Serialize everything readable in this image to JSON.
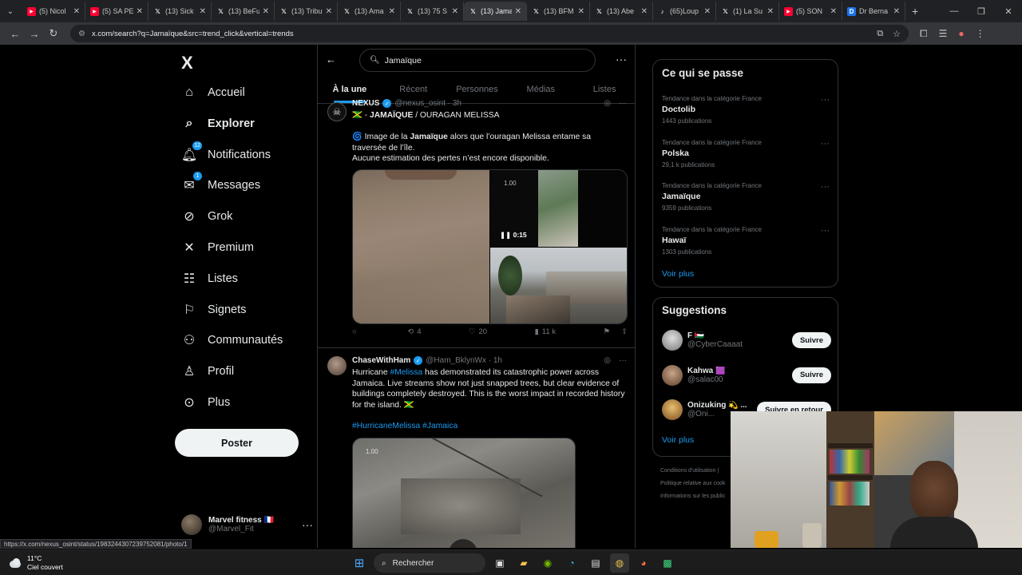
{
  "browser": {
    "tabs": [
      {
        "label": "(5) Nicol",
        "favicon": "youtube",
        "color": "#ff0033"
      },
      {
        "label": "(5) SA PE",
        "favicon": "youtube",
        "color": "#ff0033"
      },
      {
        "label": "(13) Sick",
        "favicon": "x",
        "color": "#000000"
      },
      {
        "label": "(13) BeFu",
        "favicon": "x",
        "color": "#000000"
      },
      {
        "label": "(13) Tribu",
        "favicon": "x",
        "color": "#000000"
      },
      {
        "label": "(13) Ama",
        "favicon": "x",
        "color": "#000000"
      },
      {
        "label": "(13) 75 S",
        "favicon": "x",
        "color": "#000000"
      },
      {
        "label": "(13) Jama",
        "favicon": "x",
        "color": "#000000",
        "active": true
      },
      {
        "label": "(13) BFM",
        "favicon": "x",
        "color": "#000000"
      },
      {
        "label": "(13) Abe",
        "favicon": "x",
        "color": "#000000"
      },
      {
        "label": "(65)Loup",
        "favicon": "tiktok",
        "color": "#000000"
      },
      {
        "label": "(1) La Su",
        "favicon": "x",
        "color": "#000000"
      },
      {
        "label": "(5) SON",
        "favicon": "youtube",
        "color": "#ff0033"
      },
      {
        "label": "Dr Berna",
        "favicon": "doc",
        "color": "#1a73e8"
      }
    ],
    "url": "x.com/search?q=Jamaïque&src=trend_click&vertical=trends",
    "status_url": "https://x.com/nexus_osint/status/1983244307239752081/photo/1"
  },
  "sidebar": {
    "logo": "X",
    "items": [
      {
        "label": "Accueil",
        "icon": "home-icon"
      },
      {
        "label": "Explorer",
        "icon": "search-icon",
        "bold": true
      },
      {
        "label": "Notifications",
        "icon": "bell-icon",
        "badge": "12"
      },
      {
        "label": "Messages",
        "icon": "mail-icon",
        "badge": "1"
      },
      {
        "label": "Grok",
        "icon": "grok-icon"
      },
      {
        "label": "Premium",
        "icon": "x-icon"
      },
      {
        "label": "Listes",
        "icon": "list-icon"
      },
      {
        "label": "Signets",
        "icon": "bookmark-icon"
      },
      {
        "label": "Communautés",
        "icon": "people-icon"
      },
      {
        "label": "Profil",
        "icon": "person-icon"
      },
      {
        "label": "Plus",
        "icon": "more-circle-icon"
      }
    ],
    "post_label": "Poster",
    "account": {
      "name": "Marvel fitness 🇫🇷",
      "handle": "@Marvel_Fit"
    }
  },
  "search": {
    "query": "Jamaïque",
    "tabs": [
      "À la une",
      "Récent",
      "Personnes",
      "Médias",
      "Listes"
    ]
  },
  "tweets": [
    {
      "name": "NEXUS",
      "handle": "@nexus_osint · 3h",
      "title_prefix": "🇯🇲 - ",
      "title_bold": "JAMAÏQUE",
      "title_rest": " / OURAGAN MELISSA",
      "line1_pre": "🌀 Image de la ",
      "line1_bold": "Jamaïque",
      "line1_post": " alors que l’ouragan Melissa entame sa traversée de l’île.",
      "line2": "Aucune estimation des pertes n’est encore disponible.",
      "video_speed": "1.00",
      "video_time": "0:15",
      "replies": "",
      "reposts": "4",
      "likes": "20",
      "views": "11 k"
    },
    {
      "name": "ChaseWithHam",
      "handle": "@Ham_BklynWx · 1h",
      "text_pre": "Hurricane ",
      "hashtag1": "#Melissa",
      "text_post": " has demonstrated its catastrophic power across Jamaica. Live streams show not just snapped trees, but clear evidence of buildings completely destroyed. This is the worst impact in recorded history for the island. 🇯🇲",
      "hashtags": "#HurricaneMelissa #Jamaica",
      "video_speed": "1.00"
    }
  ],
  "trends": {
    "title": "Ce qui se passe",
    "items": [
      {
        "category": "Tendance dans la catégorie France",
        "name": "Doctolib",
        "count": "1443 publications"
      },
      {
        "category": "Tendance dans la catégorie France",
        "name": "Polska",
        "count": "29,1 k publications"
      },
      {
        "category": "Tendance dans la catégorie France",
        "name": "Jamaïque",
        "count": "9359 publications"
      },
      {
        "category": "Tendance dans la catégorie France",
        "name": "Hawaï",
        "count": "1303 publications"
      }
    ],
    "see_more": "Voir plus"
  },
  "suggestions": {
    "title": "Suggestions",
    "items": [
      {
        "name": "F 🇵🇸",
        "handle": "@CyberCaaaat",
        "button": "Suivre"
      },
      {
        "name": "Kahwa 🟪",
        "handle": "@salac00",
        "button": "Suivre"
      },
      {
        "name": "Onizuking 💫 ...",
        "handle": "@Oni...",
        "button": "Suivre en retour"
      }
    ],
    "see_more": "Voir plus"
  },
  "footer": [
    "Conditions d'utilisation |",
    "Politique relative aux cook",
    "Informations sur les public"
  ],
  "taskbar": {
    "temp": "11°C",
    "weather": "Ciel couvert",
    "search_label": "Rechercher"
  }
}
